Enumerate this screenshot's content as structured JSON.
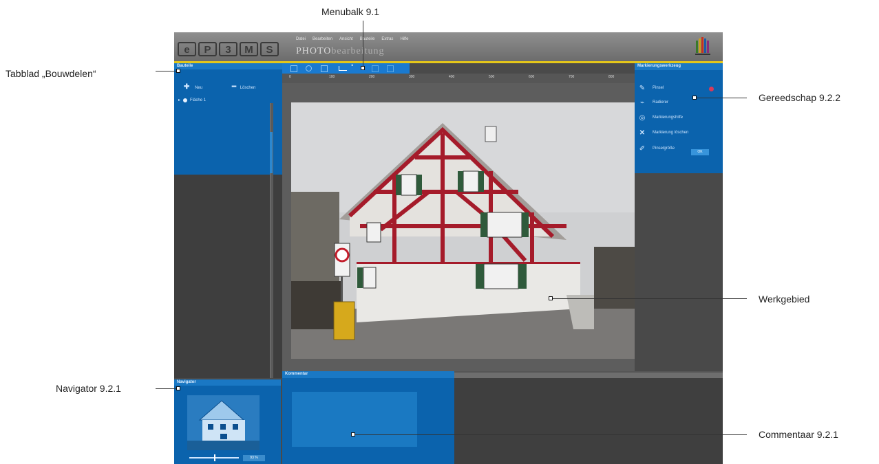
{
  "callouts": {
    "menubalk": "Menubalk 9.1",
    "tabblad": "Tabblad „Bouwdelen“",
    "gereedschap": "Gereedschap  9.2.2",
    "werkgebied": "Werkgebied",
    "navigator": "Navigator 9.2.1",
    "commentaar": "Commentaar 9.2.1"
  },
  "app": {
    "logo_letters": [
      "e",
      "P",
      "3",
      "M",
      "S"
    ],
    "menu": [
      "Datei",
      "Bearbeiten",
      "Ansicht",
      "Bauteile",
      "Extras",
      "Hilfe"
    ],
    "product_name_prefix": "PHOTO",
    "product_name_suffix": "bearbeitung",
    "brand_icon": "caparol-logo-icon",
    "colors": {
      "accent": "#0b63ad",
      "highlight": "#e5c719",
      "marker": "#d83a5a"
    }
  },
  "left_panel": {
    "title": "Bauteile",
    "tools": [
      {
        "icon": "plus-icon",
        "label": "Neu"
      },
      {
        "icon": "minus-icon",
        "label": "Löschen"
      }
    ],
    "items": [
      {
        "label": "Fläche 1"
      }
    ]
  },
  "navigator": {
    "title": "Navigator",
    "zoom": "93 %"
  },
  "toolbar": {
    "icons": [
      "select-icon",
      "zoom-icon",
      "hand-icon",
      "crop-icon",
      "rotate-icon",
      "undo-icon",
      "redo-icon"
    ]
  },
  "ruler": {
    "ticks": [
      "0",
      "100",
      "200",
      "300",
      "400",
      "500",
      "600",
      "700",
      "800"
    ]
  },
  "right_panel": {
    "title": "Markierungswerkzeug",
    "rows": [
      {
        "icon": "brush-icon",
        "label": "Pinsel"
      },
      {
        "icon": "eraser-icon",
        "label": "Radierer"
      },
      {
        "icon": "magic-wand-icon",
        "label": "Markierungshilfe"
      },
      {
        "icon": "close-icon",
        "label": "Markierung löschen"
      },
      {
        "icon": "pen-icon",
        "label": "Pinselgröße"
      }
    ],
    "ok_label": "OK"
  },
  "comment": {
    "title": "Kommentar"
  }
}
